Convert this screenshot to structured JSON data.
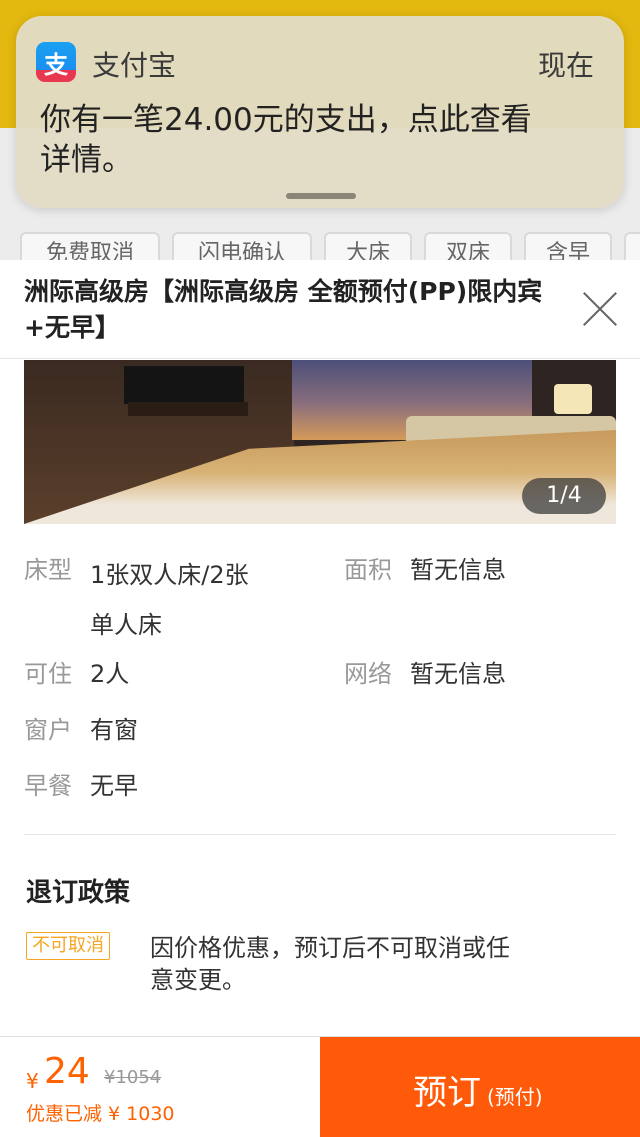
{
  "notification": {
    "app_name": "支付宝",
    "time": "现在",
    "message": "你有一笔24.00元的支出，点此查看详情。",
    "icon": "alipay-icon",
    "icon_badge": "支"
  },
  "filters": [
    "免费取消",
    "闪电确认",
    "大床",
    "双床",
    "含早"
  ],
  "sheet": {
    "title": "洲际高级房【洲际高级房  全额预付(PP)限内宾+无早】",
    "photo_counter": "1/4",
    "details": {
      "bed_label": "床型",
      "bed_value": "1张双人床/2张单人床",
      "area_label": "面积",
      "area_value": "暂无信息",
      "occupancy_label": "可住",
      "occupancy_value": "2人",
      "network_label": "网络",
      "network_value": "暂无信息",
      "window_label": "窗户",
      "window_value": "有窗",
      "breakfast_label": "早餐",
      "breakfast_value": "无早"
    },
    "policy": {
      "title": "退订政策",
      "tag": "不可取消",
      "text": "因价格优惠，预订后不可取消或任意变更。"
    }
  },
  "bottom": {
    "currency": "¥",
    "price": "24",
    "original_price": "¥1054",
    "discount_text": "优惠已减 ¥ 1030",
    "book_label": "预订",
    "book_sub": "(预付)"
  },
  "colors": {
    "accent": "#ff5a0a",
    "tag": "#f5a623",
    "header_bg": "#e3b80f"
  }
}
